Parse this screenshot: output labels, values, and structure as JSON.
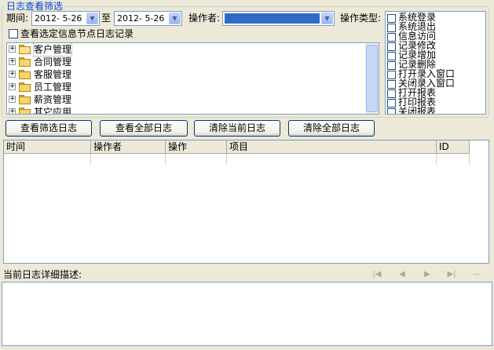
{
  "filter": {
    "title": "日志查看筛选",
    "period_label": "期间:",
    "date_from": "2012- 5-26",
    "to_label": "至",
    "date_to": "2012- 5-26",
    "operator_label": "操作者:",
    "operator_value": "",
    "op_type_label": "操作类型:",
    "view_node_log_label": "查看选定信息节点日志记录"
  },
  "tree": {
    "items": [
      {
        "label": "客户管理",
        "expander": "+",
        "open": true
      },
      {
        "label": "合同管理",
        "expander": "+",
        "open": false
      },
      {
        "label": "客服管理",
        "expander": "+",
        "open": false
      },
      {
        "label": "员工管理",
        "expander": "+",
        "open": false
      },
      {
        "label": "薪资管理",
        "expander": "+",
        "open": false
      },
      {
        "label": "其它应用",
        "expander": "+",
        "open": false
      }
    ]
  },
  "op_types": [
    "系统登录",
    "系统退出",
    "信息访问",
    "记录修改",
    "记录增加",
    "记录删除",
    "打开录入窗口",
    "关闭录入窗口",
    "打开报表",
    "打印报表",
    "关闭报表"
  ],
  "buttons": {
    "view_filtered": "查看筛选日志",
    "view_all": "查看全部日志",
    "clear_current": "清除当前日志",
    "clear_all": "清除全部日志"
  },
  "grid": {
    "columns": [
      "时间",
      "操作者",
      "操作",
      "项目",
      "ID"
    ]
  },
  "detail": {
    "label": "当前日志详细描述:",
    "nav": [
      "first-icon",
      "prev-icon",
      "next-icon",
      "last-icon",
      "minus-icon"
    ]
  },
  "colors": {
    "accent": "#0046D5",
    "selection": "#316AC5",
    "border": "#7F9DB9",
    "background": "#ECE9D8"
  }
}
